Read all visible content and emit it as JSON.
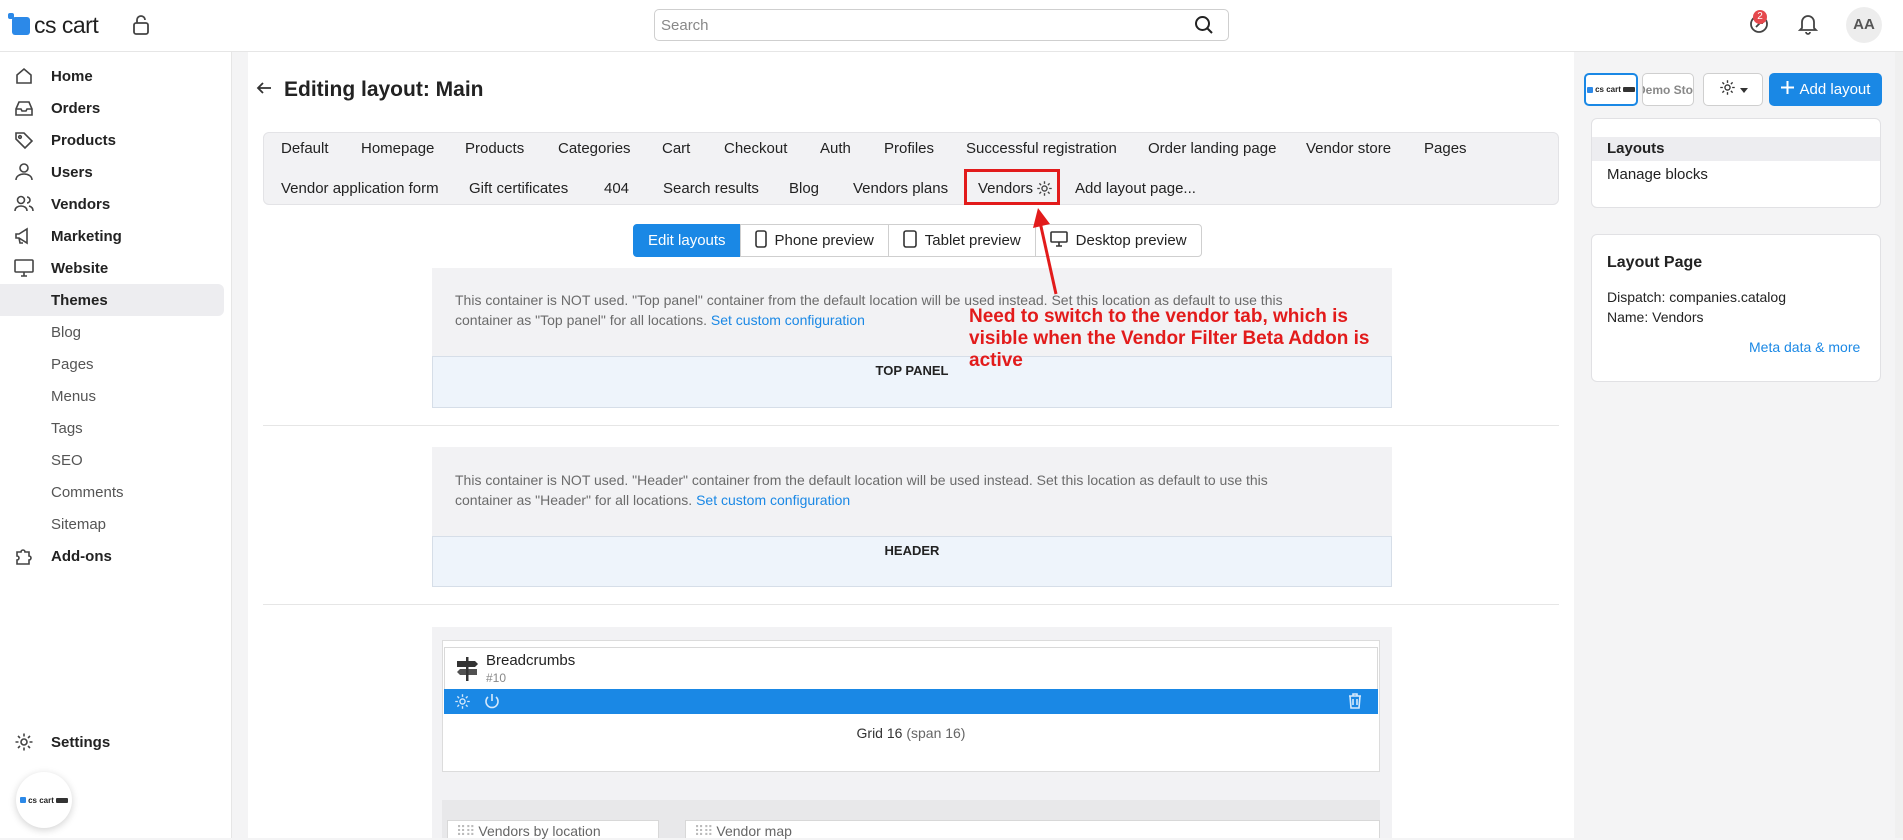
{
  "topbar": {
    "logo_text": "cs cart",
    "search_placeholder": "Search",
    "notification_count": "2",
    "avatar_initials": "AA"
  },
  "sidebar": {
    "items": [
      {
        "label": "Home",
        "icon": "home-icon"
      },
      {
        "label": "Orders",
        "icon": "inbox-icon"
      },
      {
        "label": "Products",
        "icon": "tag-icon"
      },
      {
        "label": "Users",
        "icon": "user-icon"
      },
      {
        "label": "Vendors",
        "icon": "users-icon"
      },
      {
        "label": "Marketing",
        "icon": "megaphone-icon"
      },
      {
        "label": "Website",
        "icon": "monitor-icon"
      }
    ],
    "website_sub": [
      "Themes",
      "Blog",
      "Pages",
      "Menus",
      "Tags",
      "SEO",
      "Comments",
      "Sitemap"
    ],
    "addons": "Add-ons",
    "settings": "Settings",
    "store_logo": "cs cart"
  },
  "page": {
    "title": "Editing layout: Main"
  },
  "tabs": {
    "row1": [
      "Default",
      "Homepage",
      "Products",
      "Categories",
      "Cart",
      "Checkout",
      "Auth",
      "Profiles",
      "Successful registration",
      "Order landing page",
      "Vendor store",
      "Pages"
    ],
    "row2": [
      "Vendor application form",
      "Gift certificates",
      "404",
      "Search results",
      "Blog",
      "Vendors plans",
      "Vendors",
      "Add layout page..."
    ]
  },
  "preview": {
    "edit": "Edit layouts",
    "phone": "Phone preview",
    "tablet": "Tablet preview",
    "desktop": "Desktop preview"
  },
  "containers": {
    "top_panel": {
      "note_1": "This container is NOT used. \"Top panel\" container from the default location will be used instead. Set this location as default to use this",
      "note_2": "container as \"Top panel\" for all locations.",
      "link": "Set custom configuration",
      "title": "TOP PANEL"
    },
    "header": {
      "note_1": "This container is NOT used. \"Header\" container from the default location will be used instead. Set this location as default to use this",
      "note_2": "container as \"Header\" for all locations.",
      "link": "Set custom configuration",
      "title": "HEADER"
    }
  },
  "content": {
    "block_name": "Breadcrumbs",
    "block_id": "#10",
    "grid_label": "Grid 16",
    "grid_span": "(span 16)",
    "bottom_block_1": "Vendors by location",
    "bottom_block_2": "Vendor map"
  },
  "annotation": {
    "text": "Need to switch to the vendor tab, which is visible when the Vendor Filter Beta Addon is active",
    "color": "#e21b1b"
  },
  "right_panel": {
    "store_1": "cs cart",
    "store_2": "Demo Store",
    "add_layout": "Add layout",
    "layouts": "Layouts",
    "manage_blocks": "Manage blocks",
    "layout_page_title": "Layout Page",
    "dispatch": "Dispatch: companies.catalog",
    "name": "Name: Vendors",
    "meta_link": "Meta data & more"
  },
  "colors": {
    "accent": "#1a88e5",
    "highlight": "#e21b1b"
  }
}
